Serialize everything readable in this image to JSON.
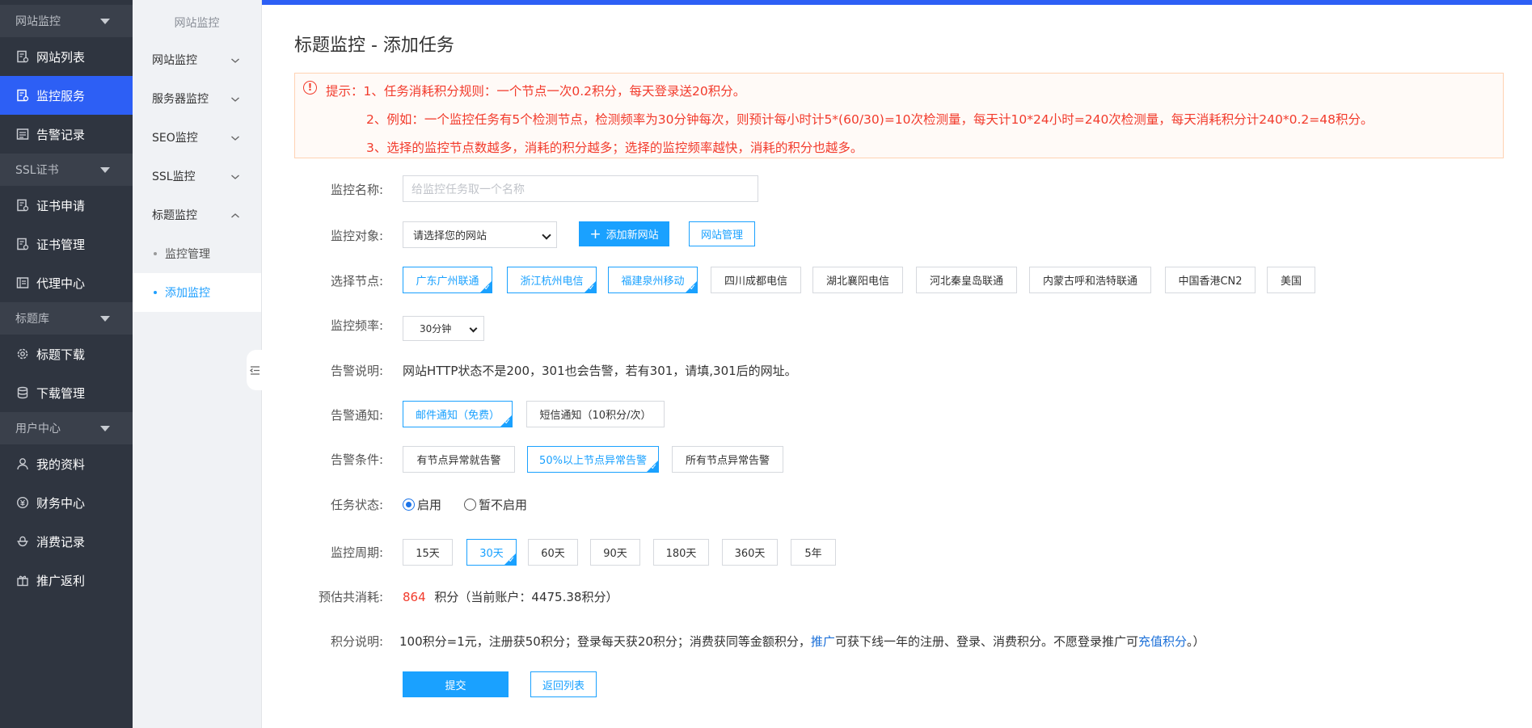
{
  "colors": {
    "accent": "#1aa1ff",
    "nav_active": "#2d5ff5",
    "nav_bg": "#2f3540",
    "warning": "#f23b2c"
  },
  "leftnav": {
    "groups": [
      {
        "label": "网站监控",
        "items": [
          {
            "label": "网站列表",
            "icon": "website-list-icon"
          },
          {
            "label": "监控服务",
            "icon": "monitor-service-icon",
            "active": true
          },
          {
            "label": "告警记录",
            "icon": "alert-record-icon"
          }
        ]
      },
      {
        "label": "SSL证书",
        "items": [
          {
            "label": "证书申请",
            "icon": "cert-apply-icon"
          },
          {
            "label": "证书管理",
            "icon": "cert-manage-icon"
          },
          {
            "label": "代理中心",
            "icon": "agent-center-icon"
          }
        ]
      },
      {
        "label": "标题库",
        "items": [
          {
            "label": "标题下载",
            "icon": "gear-icon"
          },
          {
            "label": "下载管理",
            "icon": "database-icon"
          }
        ]
      },
      {
        "label": "用户中心",
        "items": [
          {
            "label": "我的资料",
            "icon": "user-icon"
          },
          {
            "label": "财务中心",
            "icon": "finance-icon"
          },
          {
            "label": "消费记录",
            "icon": "consume-icon"
          },
          {
            "label": "推广返利",
            "icon": "gift-icon"
          }
        ]
      }
    ]
  },
  "subnav": {
    "title": "网站监控",
    "items": [
      "网站监控",
      "服务器监控",
      "SEO监控",
      "SSL监控",
      "标题监控"
    ],
    "children": [
      "监控管理",
      "添加监控"
    ]
  },
  "page": {
    "title": "标题监控 - 添加任务",
    "tip": {
      "line1": "提示：1、任务消耗积分规则：一个节点一次0.2积分，每天登录送20积分。",
      "line2": "2、例如：一个监控任务有5个检测节点，检测频率为30分钟每次，则预计每小时计5*(60/30)=10次检测量，每天计10*24小时=240次检测量，每天消耗积分计240*0.2=48积分。",
      "line3": "3、选择的监控节点数越多，消耗的积分越多；选择的监控频率越快，消耗的积分也越多。"
    }
  },
  "form": {
    "name_label": "监控名称:",
    "name_placeholder": "给监控任务取一个名称",
    "target_label": "监控对象:",
    "target_select": "请选择您的网站",
    "add_site_button": "添加新网站",
    "site_manage_button": "网站管理",
    "nodes_label": "选择节点:",
    "nodes": [
      "广东广州联通",
      "浙江杭州电信",
      "福建泉州移动",
      "四川成都电信",
      "湖北襄阳电信",
      "河北秦皇岛联通",
      "内蒙古呼和浩特联通",
      "中国香港CN2",
      "美国"
    ],
    "nodes_selected": [
      0,
      1,
      2
    ],
    "freq_label": "监控频率:",
    "freq_value": "30分钟",
    "alert_desc_label": "告警说明:",
    "alert_desc": "网站HTTP状态不是200，301也会告警，若有301，请填,301后的网址。",
    "notify_label": "告警通知:",
    "notify_options": [
      "邮件通知（免费）",
      "短信通知（10积分/次）"
    ],
    "notify_selected": 0,
    "condition_label": "告警条件:",
    "conditions": [
      "有节点异常就告警",
      "50%以上节点异常告警",
      "所有节点异常告警"
    ],
    "condition_selected": 1,
    "status_label": "任务状态:",
    "status_on": "启用",
    "status_off": "暂不启用",
    "period_label": "监控周期:",
    "periods": [
      "15天",
      "30天",
      "60天",
      "90天",
      "180天",
      "360天",
      "5年"
    ],
    "period_selected": 1,
    "estimate_label": "预估共消耗:",
    "estimate_value": "864",
    "estimate_rest": "积分（当前账户：4475.38积分）",
    "points_label": "积分说明:",
    "points_text1": "100积分=1元，注册获50积分；登录每天获20积分；消费获同等金额积分，",
    "points_link1": "推广",
    "points_text2": "可获下线一年的注册、登录、消费积分。不愿登录推广可",
    "points_link2": "充值积分",
    "points_text3": "。）",
    "submit_button": "提交",
    "back_button": "返回列表"
  }
}
